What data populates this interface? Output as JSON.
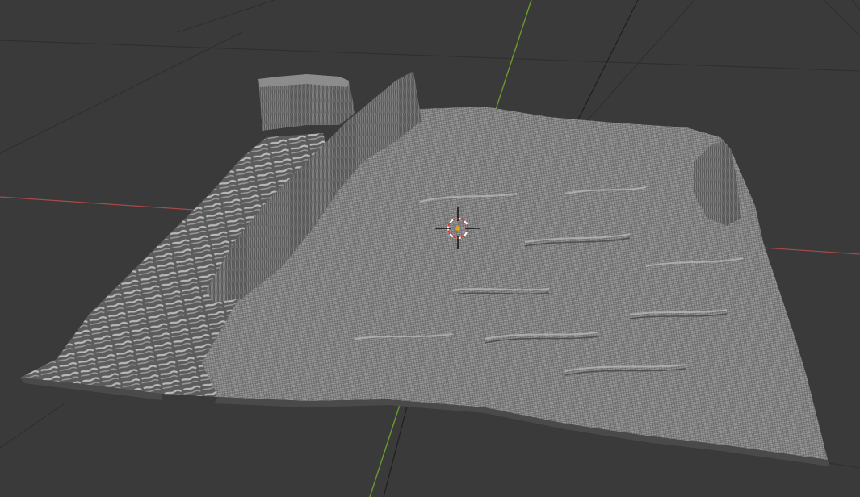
{
  "viewport": {
    "background": "#3a3a3a",
    "grid_color": "#2f2f2f",
    "x_axis_color": "#a64a4a",
    "y_axis_color": "#6c9a2a"
  },
  "terrain": {
    "type": "displaced-heightmap-mesh",
    "shading": "solid",
    "fill_color": "#7b7b7b",
    "wire_color": "#aaaaaa",
    "dark_color": "#4a4a4a",
    "features": [
      "mesa-cliffs",
      "ridge-line",
      "eroded-valley",
      "flat-plain"
    ]
  },
  "cursor_3d": {
    "icon": "3d-cursor-crosshair-icon",
    "ring_colors": [
      "#d23b3b",
      "#ffffff"
    ],
    "center_color": "#e0a020"
  }
}
